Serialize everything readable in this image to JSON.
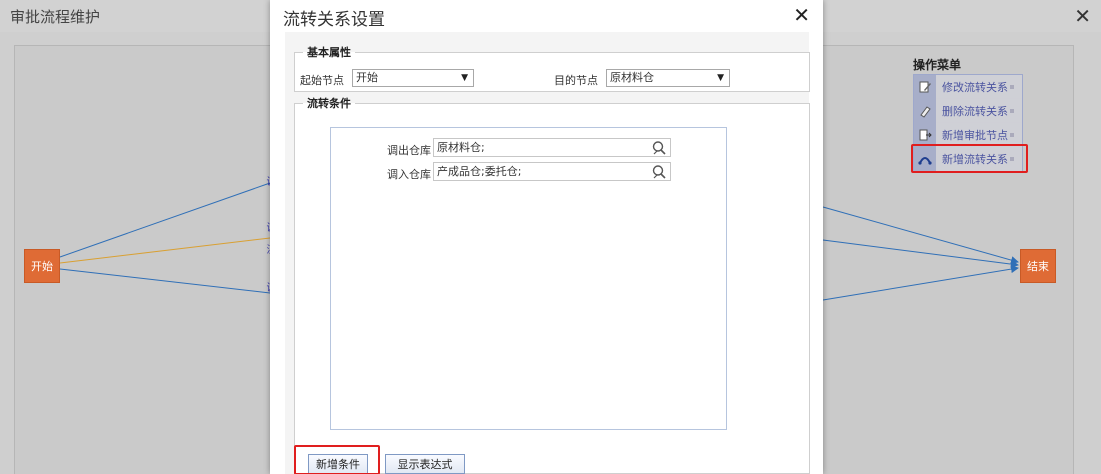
{
  "background": {
    "title": "审批流程维护",
    "close_icon": "close-icon",
    "flow": {
      "start_node": "开始",
      "end_node": "结束",
      "edge_labels": [
        "调",
        "调",
        "汉",
        "调"
      ]
    },
    "operation_menu": {
      "title": "操作菜单",
      "items": [
        {
          "label": "修改流转关系",
          "icon": "edit-icon"
        },
        {
          "label": "删除流转关系",
          "icon": "eraser-icon"
        },
        {
          "label": "新增审批节点",
          "icon": "add-node-icon"
        },
        {
          "label": "新增流转关系",
          "icon": "add-relation-icon"
        }
      ]
    }
  },
  "modal": {
    "title": "流转关系设置",
    "basic": {
      "legend": "基本属性",
      "start_label": "起始节点",
      "start_value": "开始",
      "target_label": "目的节点",
      "target_value": "原材料仓"
    },
    "conditions": {
      "legend": "流转条件",
      "rows": [
        {
          "label": "调出仓库",
          "value": "原材料仓;"
        },
        {
          "label": "调入仓库",
          "value": "产成品仓;委托仓;"
        }
      ]
    },
    "buttons": {
      "add_condition": "新增条件",
      "show_expression": "显示表达式"
    }
  },
  "colors": {
    "node": "#df6b35",
    "edge_blue": "#2f6fb7",
    "edge_orange": "#d9a032",
    "highlight": "#e01e1e"
  }
}
